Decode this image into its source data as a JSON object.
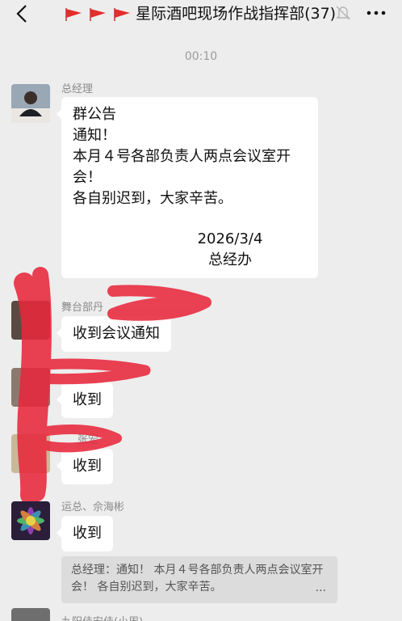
{
  "header": {
    "back_icon": "chevron-left-icon",
    "title_flags": [
      "red-flag-icon",
      "red-flag-icon",
      "red-flag-icon"
    ],
    "title": "星际酒吧现场作战指挥部(37)",
    "mute_icon": "bell-muted-icon",
    "more_icon": "more-dots-icon"
  },
  "timestamp": "00:10",
  "messages": [
    {
      "sender": "总经理",
      "lines": [
        "群公告",
        "通知！",
        "本月４号各部负责人两点会议室开",
        "会！",
        "各自别迟到，大家辛苦。"
      ],
      "sign_date": "2026/3/4",
      "sign_org": "总经办"
    },
    {
      "sender": "舞台部丹",
      "text": "收到会议通知"
    },
    {
      "sender": "",
      "text": "收到"
    },
    {
      "sender": "张宏",
      "text": "收到"
    },
    {
      "sender": "运总、佘海彬",
      "text": "收到"
    }
  ],
  "quote": {
    "text": "总经理：通知！ 本月４号各部负责人两点会议室开会！ 各自别迟到，大家辛苦。",
    "ellipsis": "..."
  },
  "cut_sender": "九阳佳安佳(小周)",
  "colors": {
    "bg": "#ededed",
    "bubble": "#ffffff",
    "redact": "#e8283c"
  }
}
